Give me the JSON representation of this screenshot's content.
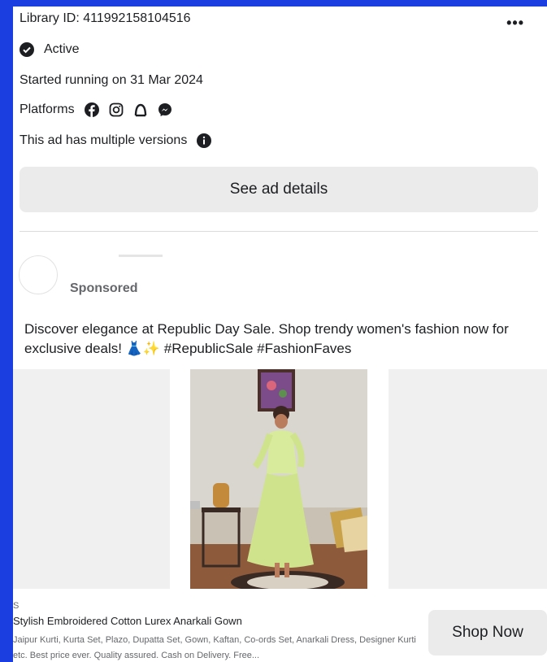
{
  "ad": {
    "library_id": "Library ID: 411992158104516",
    "status": "Active",
    "started": "Started running on 31 Mar 2024",
    "platforms_label": "Platforms",
    "platforms": [
      "facebook-icon",
      "instagram-icon",
      "audience-network-icon",
      "messenger-icon"
    ],
    "versions_note": "This ad has multiple versions",
    "details_button": "See ad details"
  },
  "post": {
    "sponsored": "Sponsored",
    "text": "Discover elegance at Republic Day Sale. Shop trendy women's fashion now for exclusive deals! 👗✨ #RepublicSale #FashionFaves"
  },
  "link": {
    "source": "S",
    "title": "Stylish Embroidered Cotton Lurex Anarkali Gown",
    "description": "Jaipur Kurti, Kurta Set, Plazo, Dupatta Set, Gown, Kaftan, Co-ords Set, Anarkali Dress, Designer Kurti etc. Best price ever. Quality assured. Cash on Delivery. Free...",
    "cta": "Shop Now"
  },
  "colors": {
    "frame": "#1b3ee0",
    "button_bg": "#ebebeb",
    "muted_text": "#65676b"
  }
}
